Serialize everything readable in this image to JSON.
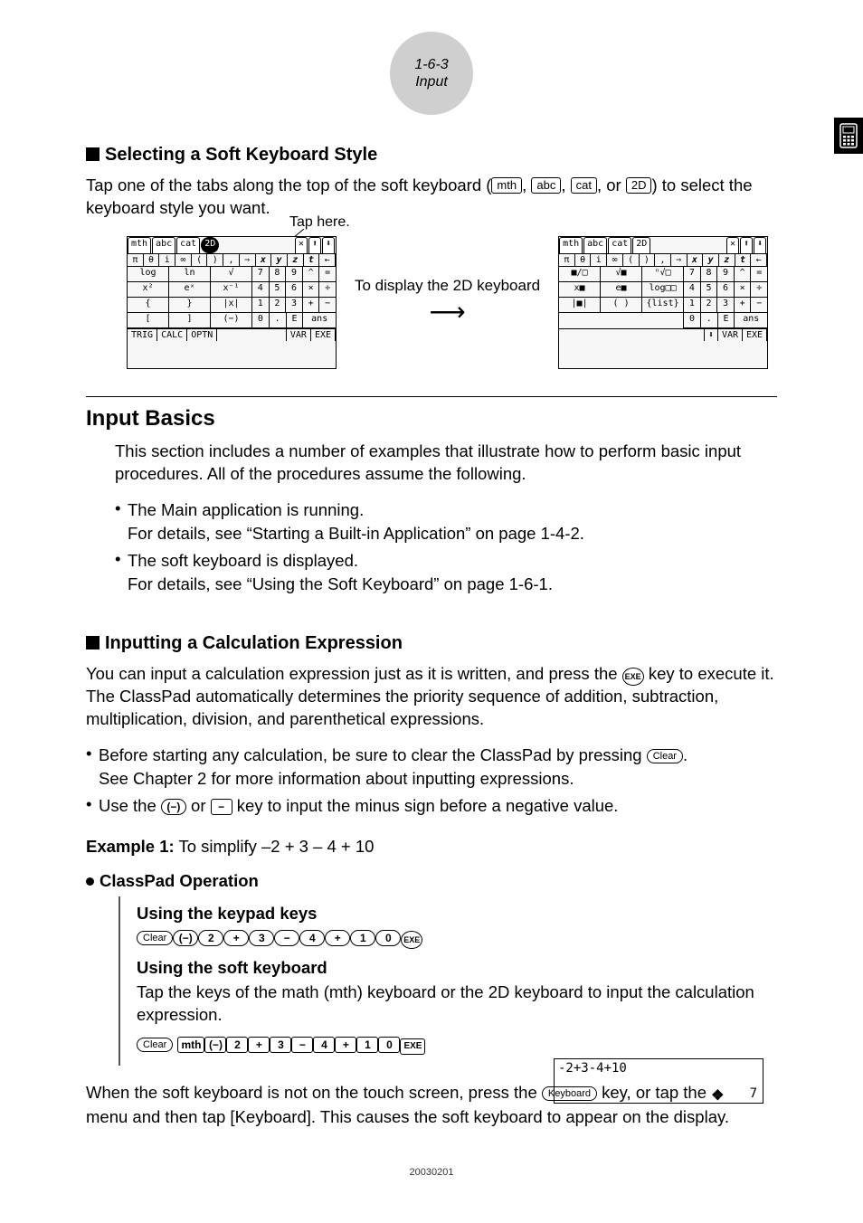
{
  "header": {
    "line1": "1-6-3",
    "line2": "Input"
  },
  "section1": {
    "title": "Selecting a Soft Keyboard Style",
    "para_a": "Tap one of the tabs along the top of the soft keyboard (",
    "tab1": "mth",
    "sep": ", ",
    "tab2": "abc",
    "tab3": "cat",
    "sep_or": ", or ",
    "tab4": "2D",
    "para_b": ") to select the keyboard style you want.",
    "tap_here": "Tap here.",
    "mid_label": "To display the 2D keyboard",
    "kb_a": {
      "tabs": [
        "mth",
        "abc",
        "cat",
        "2D"
      ],
      "top": [
        "π",
        "θ",
        "i",
        "∞",
        "(",
        ")",
        ",",
        "⇒",
        "x",
        "y",
        "z",
        "t",
        "←"
      ],
      "rows_left": [
        [
          "log",
          "ln",
          "√"
        ],
        [
          "x²",
          "eˣ",
          "x⁻¹"
        ],
        [
          "{",
          "}",
          "|x|"
        ],
        [
          "[",
          "]",
          "(−)"
        ]
      ],
      "rows_right": [
        [
          "7",
          "8",
          "9",
          "^",
          "="
        ],
        [
          "4",
          "5",
          "6",
          "×",
          "÷"
        ],
        [
          "1",
          "2",
          "3",
          "+",
          "−"
        ],
        [
          "0",
          ".",
          "E",
          "ans"
        ]
      ],
      "bottom": [
        "TRIG",
        "CALC",
        "OPTN",
        "VAR",
        "EXE"
      ]
    },
    "kb_b": {
      "tabs": [
        "mth",
        "abc",
        "cat",
        "2D"
      ],
      "top": [
        "π",
        "θ",
        "i",
        "∞",
        "(",
        ")",
        ",",
        "⇒",
        "x",
        "y",
        "z",
        "t",
        "←"
      ],
      "rows_left": [
        [
          "■/□",
          "√■",
          "ⁿ√□"
        ],
        [
          "x■",
          "e■",
          "log□□"
        ],
        [
          "|■|",
          "( )",
          "{list}"
        ]
      ],
      "rows_right": [
        [
          "7",
          "8",
          "9",
          "^",
          "="
        ],
        [
          "4",
          "5",
          "6",
          "×",
          "÷"
        ],
        [
          "1",
          "2",
          "3",
          "+",
          "−"
        ],
        [
          "0",
          ".",
          "E",
          "ans"
        ]
      ],
      "bottom_right": [
        "VAR",
        "EXE"
      ]
    }
  },
  "section2": {
    "title": "Input Basics",
    "intro": "This section includes a number of examples that illustrate how to perform basic input procedures. All of the procedures assume the following.",
    "bullets": [
      {
        "l1": "The Main application is running.",
        "l2": "For details, see “Starting a Built-in Application” on page 1-4-2."
      },
      {
        "l1": "The soft keyboard is displayed.",
        "l2": "For details, see “Using the Soft Keyboard” on page 1-6-1."
      }
    ]
  },
  "section3": {
    "title": "Inputting a Calculation Expression",
    "para_a": "You can input a calculation expression just as it is written, and press the ",
    "exe": "EXE",
    "para_b": " key to execute it. The ClassPad automatically determines the priority sequence of addition, subtraction, multiplication, division, and parenthetical expressions.",
    "b1_a": "Before starting any calculation, be sure to clear the ClassPad by pressing ",
    "clear": "Clear",
    "b1_b": ".",
    "b1_c": "See Chapter 2 for more information about inputting expressions.",
    "b2_a": "Use the ",
    "neg1": "(−)",
    "b2_mid": " or ",
    "neg2": "−",
    "b2_b": " key to input the minus sign before a negative value.",
    "example_label": "Example 1:",
    "example_text": "  To simplify –2 + 3 – 4 + 10",
    "op_header": "ClassPad Operation",
    "op1_label": "Using the keypad keys",
    "op1_seq": [
      "Clear",
      "(−)",
      "2",
      "+",
      "3",
      "−",
      "4",
      "+",
      "1",
      "0",
      "EXE"
    ],
    "op2_label": "Using the soft keyboard",
    "op2_text": "Tap the keys of the math (mth) keyboard or the 2D keyboard to input the calculation expression.",
    "op2_seq_round": "Clear",
    "op2_seq_sq": [
      "mth",
      "(−)",
      "2",
      "+",
      "3",
      "−",
      "4",
      "+",
      "1",
      "0",
      "EXE"
    ],
    "result_in": "-2+3-4+10",
    "result_out": "7",
    "foot_a": "When the soft keyboard is not on the touch screen, press the ",
    "keyboard": "Keyboard",
    "foot_b": " key, or tap the ",
    "foot_c": " menu and then tap [Keyboard]. This causes the soft keyboard to appear on the display."
  },
  "footer_id": "20030201"
}
